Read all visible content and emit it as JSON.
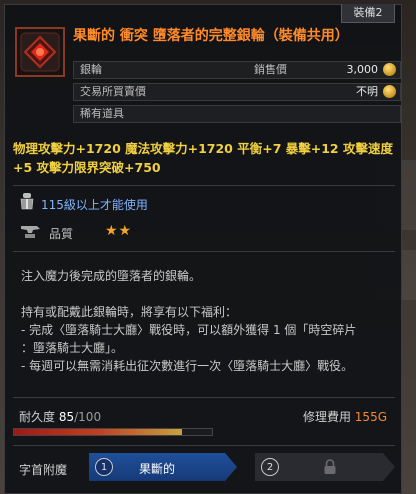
{
  "item": {
    "name": "果斷的 衝突 墮落者的完整銀輪（裝備共用）",
    "tab_label": "裝備2",
    "icon": "ring-icon",
    "rarity_color": "#ff8a2a"
  },
  "price_rows": {
    "row1": {
      "label": "銀輪",
      "mid_label": "銷售價",
      "value": "3,000",
      "icon": "coin-icon"
    },
    "row2": {
      "label": "交易所買賣價",
      "value": "不明",
      "icon": "coin-icon"
    },
    "row3": {
      "label": "稀有道具"
    }
  },
  "stats": {
    "line1": "物理攻擊力+1720 魔法攻擊力+1720 平衡+7 暴擊+12 攻擊速度",
    "line2": "+5 攻擊力限界突破+750"
  },
  "requirement": {
    "level_text": "115級以上才能使用",
    "icon": "armor-icon"
  },
  "grade": {
    "label": "品質",
    "stars": "★★",
    "star_count": 2,
    "icon": "anvil-icon"
  },
  "description": {
    "line1": "注入魔力後完成的墮落者的銀輪。",
    "line2": "持有或配戴此銀輪時，將享有以下福利：",
    "line3": "- 完成〈墮落騎士大廳〉戰役時，可以額外獲得 1 個「時空碎片",
    "line4": "：墮落騎士大廳」。",
    "line5": "- 每週可以無需消耗出征次數進行一次〈墮落騎士大廳〉戰役。"
  },
  "durability": {
    "label": "耐久度",
    "current": "85",
    "max": "/100",
    "fraction": 0.85
  },
  "repair": {
    "label": "修理費用",
    "cost": "155G"
  },
  "enchant": {
    "label": "字首附魔",
    "slot1_num": "1",
    "slot1_name": "果斷的",
    "slot2_num": "2",
    "slot2_icon": "lock-icon"
  },
  "colors": {
    "stat_text": "#f0d040",
    "requirement_text": "#7fb3ff",
    "star": "#f2a52a",
    "enchant_slot": "#1f4f9a"
  }
}
